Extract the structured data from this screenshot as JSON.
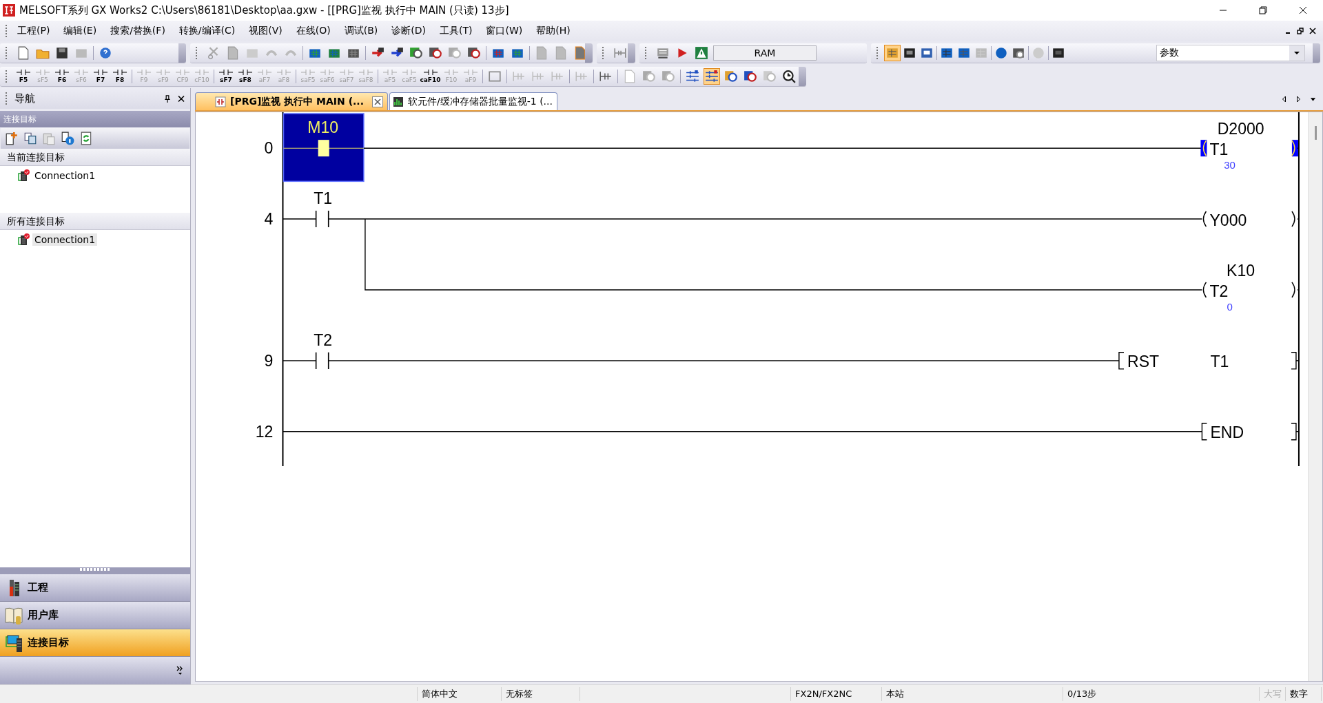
{
  "window": {
    "title": "MELSOFT系列 GX Works2 C:\\Users\\86181\\Desktop\\aa.gxw - [[PRG]监视 执行中 MAIN (只读) 13步]"
  },
  "menu": [
    "工程(P)",
    "编辑(E)",
    "搜索/替换(F)",
    "转换/编译(C)",
    "视图(V)",
    "在线(O)",
    "调试(B)",
    "诊断(D)",
    "工具(T)",
    "窗口(W)",
    "帮助(H)"
  ],
  "toolbar": {
    "memory_field": "RAM",
    "parameter_combo": "参数"
  },
  "function_key_groups": [
    [
      {
        "label": "F5",
        "disabled": false
      },
      {
        "label": "sF5",
        "disabled": true
      },
      {
        "label": "F6",
        "disabled": false
      },
      {
        "label": "sF6",
        "disabled": true
      },
      {
        "label": "F7",
        "disabled": false
      },
      {
        "label": "F8",
        "disabled": false
      }
    ],
    [
      {
        "label": "F9",
        "disabled": true
      },
      {
        "label": "sF9",
        "disabled": true
      },
      {
        "label": "CF9",
        "disabled": true
      },
      {
        "label": "cF10",
        "disabled": true
      }
    ],
    [
      {
        "label": "sF7",
        "disabled": false
      },
      {
        "label": "sF8",
        "disabled": false
      },
      {
        "label": "aF7",
        "disabled": true
      },
      {
        "label": "aF8",
        "disabled": true
      }
    ],
    [
      {
        "label": "saF5",
        "disabled": true
      },
      {
        "label": "saF6",
        "disabled": true
      },
      {
        "label": "saF7",
        "disabled": true
      },
      {
        "label": "saF8",
        "disabled": true
      }
    ],
    [
      {
        "label": "aF5",
        "disabled": true
      },
      {
        "label": "caF5",
        "disabled": true
      },
      {
        "label": "caF10",
        "disabled": false
      },
      {
        "label": "F10",
        "disabled": true
      },
      {
        "label": "aF9",
        "disabled": true
      }
    ]
  ],
  "navigation": {
    "title": "导航",
    "section": "连接目标",
    "groups": [
      {
        "title": "当前连接目标",
        "items": [
          {
            "label": "Connection1",
            "selected": false
          }
        ]
      },
      {
        "title": "所有连接目标",
        "items": [
          {
            "label": "Connection1",
            "selected": true
          }
        ]
      }
    ],
    "buttons": [
      {
        "label": "工程",
        "selected": false
      },
      {
        "label": "用户库",
        "selected": false
      },
      {
        "label": "连接目标",
        "selected": true
      }
    ]
  },
  "tabs": [
    {
      "label": "[PRG]监视 执行中 MAIN (...",
      "selected": true
    },
    {
      "label": "软元件/缓冲存储器批量监视-1 (...",
      "selected": false
    }
  ],
  "ladder": {
    "rungs": [
      {
        "step": "0",
        "contacts": [
          {
            "device": "M10",
            "energized": true,
            "cursor": true
          }
        ],
        "output": {
          "kind": "timer",
          "device": "T1",
          "setting": "D2000",
          "current": "30",
          "energized": true
        }
      },
      {
        "step": "4",
        "contacts": [
          {
            "device": "T1",
            "energized": false,
            "cursor": false
          }
        ],
        "output": {
          "kind": "coil",
          "device": "Y000",
          "energized": false
        },
        "branch": {
          "kind": "timer",
          "device": "T2",
          "setting": "K10",
          "current": "0",
          "energized": false
        }
      },
      {
        "step": "9",
        "contacts": [
          {
            "device": "T2",
            "energized": false,
            "cursor": false
          }
        ],
        "output": {
          "kind": "instruction",
          "op": "RST",
          "operand": "T1"
        }
      },
      {
        "step": "12",
        "output": {
          "kind": "end",
          "op": "END"
        }
      }
    ]
  },
  "status_bar": [
    {
      "text": "简体中文",
      "disabled": false
    },
    {
      "text": "无标签",
      "disabled": false
    },
    {
      "text": "FX2N/FX2NC",
      "disabled": false
    },
    {
      "text": "本站",
      "disabled": false
    },
    {
      "text": "0/13步",
      "disabled": false
    },
    {
      "text": "大写",
      "disabled": true
    },
    {
      "text": "数字",
      "disabled": false
    }
  ]
}
